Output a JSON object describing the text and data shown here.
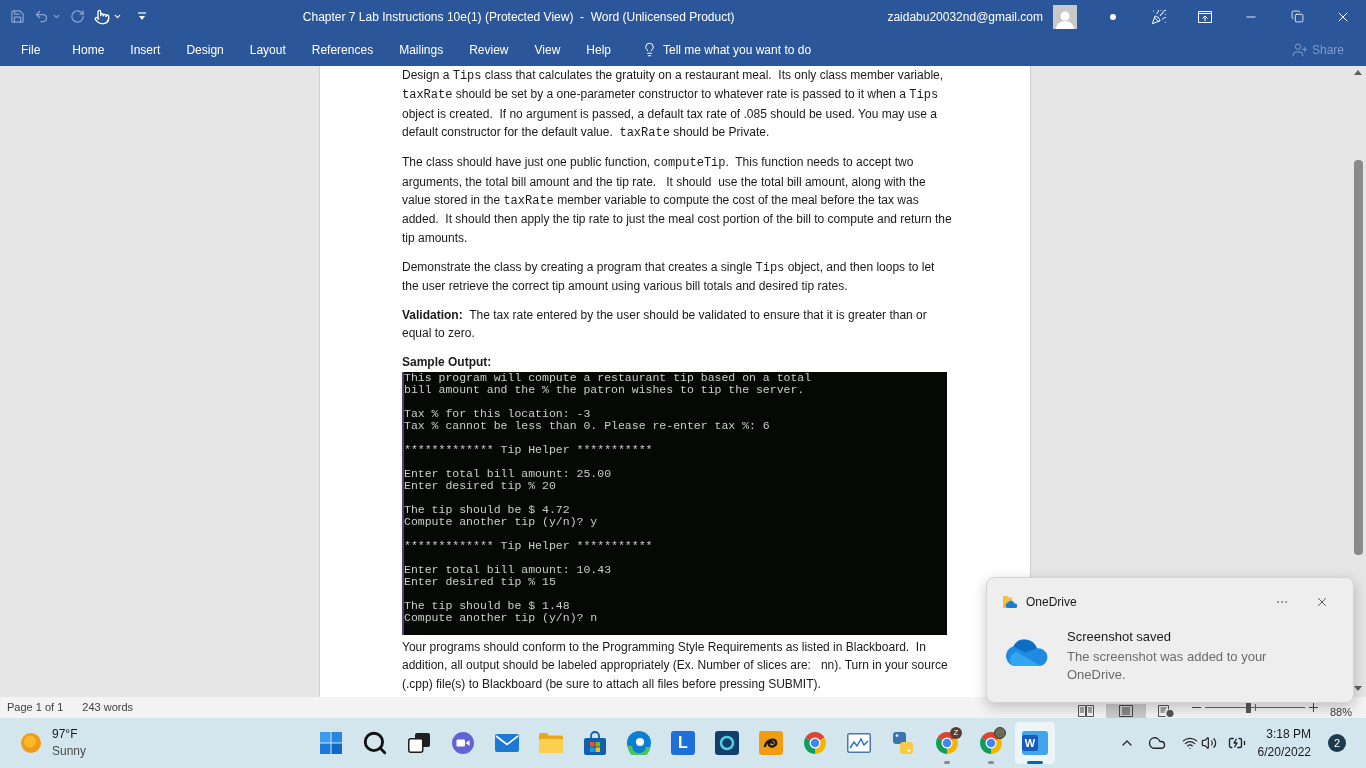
{
  "title_bar": {
    "quick_access": [
      {
        "kind": "save",
        "disabled": true,
        "dropdown": false
      },
      {
        "kind": "undo",
        "disabled": true,
        "dropdown": true
      },
      {
        "kind": "redo",
        "disabled": true,
        "dropdown": false
      },
      {
        "kind": "touch",
        "disabled": false,
        "dropdown": true
      }
    ],
    "title": "Chapter 7 Lab Instructions 10e(1) (Protected View)  -  Word (Unlicensed Product)",
    "account": "zaidabu20032nd@gmail.com"
  },
  "ribbon": {
    "tabs": [
      {
        "label": "File",
        "selected": false
      },
      {
        "label": "Home",
        "selected": false
      },
      {
        "label": "Insert",
        "selected": false
      },
      {
        "label": "Design",
        "selected": false
      },
      {
        "label": "Layout",
        "selected": false
      },
      {
        "label": "References",
        "selected": false
      },
      {
        "label": "Mailings",
        "selected": false
      },
      {
        "label": "Review",
        "selected": false
      },
      {
        "label": "View",
        "selected": false
      },
      {
        "label": "Help",
        "selected": false
      }
    ],
    "tell_me": "Tell me what you want to do",
    "share": {
      "label": "Share",
      "disabled": true
    }
  },
  "document": {
    "blocks": [
      {
        "kind": "paragraph",
        "runs": [
          {
            "kind": "plain",
            "text": "Design a "
          },
          {
            "kind": "code",
            "text": "Tips"
          },
          {
            "kind": "plain",
            "text": " class that calculates the gratuity on a restaurant meal.  Its only class member variable, "
          },
          {
            "kind": "code",
            "text": "taxRate"
          },
          {
            "kind": "plain",
            "text": " should be set by a one-parameter constructor to whatever rate is passed to it when a "
          },
          {
            "kind": "code",
            "text": "Tips"
          },
          {
            "kind": "plain",
            "text": " object is created.  If no argument is passed, a default tax rate of .085 should be used. You may use a default constructor for the default value.  "
          },
          {
            "kind": "code",
            "text": "taxRate"
          },
          {
            "kind": "plain",
            "text": " should be Private."
          }
        ]
      },
      {
        "kind": "paragraph",
        "runs": [
          {
            "kind": "plain",
            "text": "The class should have just one public function, "
          },
          {
            "kind": "code",
            "text": "computeTip"
          },
          {
            "kind": "plain",
            "text": ".  This function needs to accept two arguments, the total bill amount and the tip rate.   It should  use the total bill amount, along with the value stored in the "
          },
          {
            "kind": "code",
            "text": "taxRate"
          },
          {
            "kind": "plain",
            "text": " member variable to compute the cost of the meal before the tax was added.  It should then apply the tip rate to just the meal cost portion of the bill to compute and return the tip amounts."
          }
        ]
      },
      {
        "kind": "paragraph",
        "runs": [
          {
            "kind": "plain",
            "text": "Demonstrate the class by creating a program that creates a single "
          },
          {
            "kind": "code",
            "text": "Tips"
          },
          {
            "kind": "plain",
            "text": " object, and then loops to let the user retrieve the correct tip amount using various bill totals and desired tip rates."
          }
        ]
      },
      {
        "kind": "paragraph",
        "runs": [
          {
            "kind": "bold",
            "text": "Validation:"
          },
          {
            "kind": "plain",
            "text": "  The tax rate entered by the user should be validated to ensure that it is greater than or equal to zero."
          }
        ]
      },
      {
        "kind": "label",
        "text": "Sample Output:"
      },
      {
        "kind": "console",
        "groups": [
          [
            "This program will compute a restaurant tip based on a total",
            "bill amount and the % the patron wishes to tip the server."
          ],
          [
            "Tax % for this location: -3",
            "Tax % cannot be less than 0. Please re-enter tax %: 6"
          ],
          [
            "************* Tip Helper ***********"
          ],
          [
            "Enter total bill amount: 25.00",
            "Enter desired tip % 20"
          ],
          [
            "The tip should be $ 4.72",
            "Compute another tip (y/n)? y"
          ],
          [
            "************* Tip Helper ***********"
          ],
          [
            "Enter total bill amount: 10.43",
            "Enter desired tip % 15"
          ],
          [
            "The tip should be $ 1.48",
            "Compute another tip (y/n)? n"
          ]
        ]
      },
      {
        "kind": "paragraph",
        "runs": [
          {
            "kind": "plain",
            "text": "Your programs should conform to the Programming Style Requirements as listed in Blackboard.  In addition, all output should be labeled appropriately (Ex. Number of slices are:   nn). Turn in your source (.cpp) file(s) to Blackboard (be sure to attach all files before pressing SUBMIT)."
          }
        ]
      }
    ]
  },
  "status_bar": {
    "page": "Page 1 of 1",
    "words": "243 words",
    "views": [
      {
        "kind": "read",
        "selected": false
      },
      {
        "kind": "print",
        "selected": true
      },
      {
        "kind": "web",
        "selected": false
      }
    ],
    "zoom": {
      "level": 0.44,
      "reading": "88%"
    }
  },
  "notification": {
    "app": "OneDrive",
    "title": "Screenshot saved",
    "body": "The screenshot was added to your OneDrive."
  },
  "taskbar": {
    "weather": {
      "temperature": "97°F",
      "condition": "Sunny"
    },
    "apps": [
      {
        "kind": "start",
        "running": false,
        "selected": false
      },
      {
        "kind": "search",
        "running": false,
        "selected": false
      },
      {
        "kind": "task_view",
        "running": false,
        "selected": false
      },
      {
        "kind": "chat",
        "running": false,
        "selected": false
      },
      {
        "kind": "mail",
        "running": false,
        "selected": false
      },
      {
        "kind": "explorer",
        "running": false,
        "selected": false
      },
      {
        "kind": "store",
        "running": false,
        "selected": false
      },
      {
        "kind": "edge",
        "running": false,
        "selected": false
      },
      {
        "kind": "letter_tile",
        "label": "L",
        "running": false,
        "selected": false
      },
      {
        "kind": "ring_tile",
        "running": false,
        "selected": false
      },
      {
        "kind": "orange_tile",
        "running": false,
        "selected": false
      },
      {
        "kind": "browser",
        "running": false,
        "selected": false
      },
      {
        "kind": "monitor",
        "running": false,
        "selected": false
      },
      {
        "kind": "python",
        "running": false,
        "selected": false
      },
      {
        "kind": "browser",
        "badge": "Z",
        "running": true,
        "selected": false
      },
      {
        "kind": "browser",
        "avatar_badge": true,
        "running": true,
        "selected": false
      },
      {
        "kind": "document_tile",
        "label": "W",
        "running": true,
        "selected": true
      }
    ],
    "time": "3:18 PM",
    "date": "6/20/2022",
    "notification_count": "2"
  }
}
